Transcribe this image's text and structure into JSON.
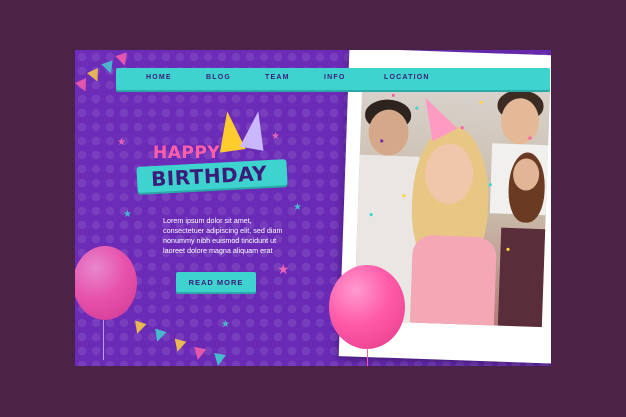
{
  "nav": {
    "items": [
      "HOME",
      "BLOG",
      "TEAM",
      "INFO",
      "LOCATION"
    ]
  },
  "hero": {
    "happy": "HAPPY",
    "birthday": "BIRTHDAY",
    "body": "Lorem ipsum dolor sit amet, consectetuer adipiscing elit, sed diam nonummy nibh euismod tincidunt ut laoreet dolore magna aliquam erat",
    "cta": "READ MORE"
  },
  "colors": {
    "background": "#4a2347",
    "panel": "#6a2bb5",
    "accent": "#3fd3cf",
    "pink": "#ff5fa8",
    "navy": "#3b1c7a"
  }
}
